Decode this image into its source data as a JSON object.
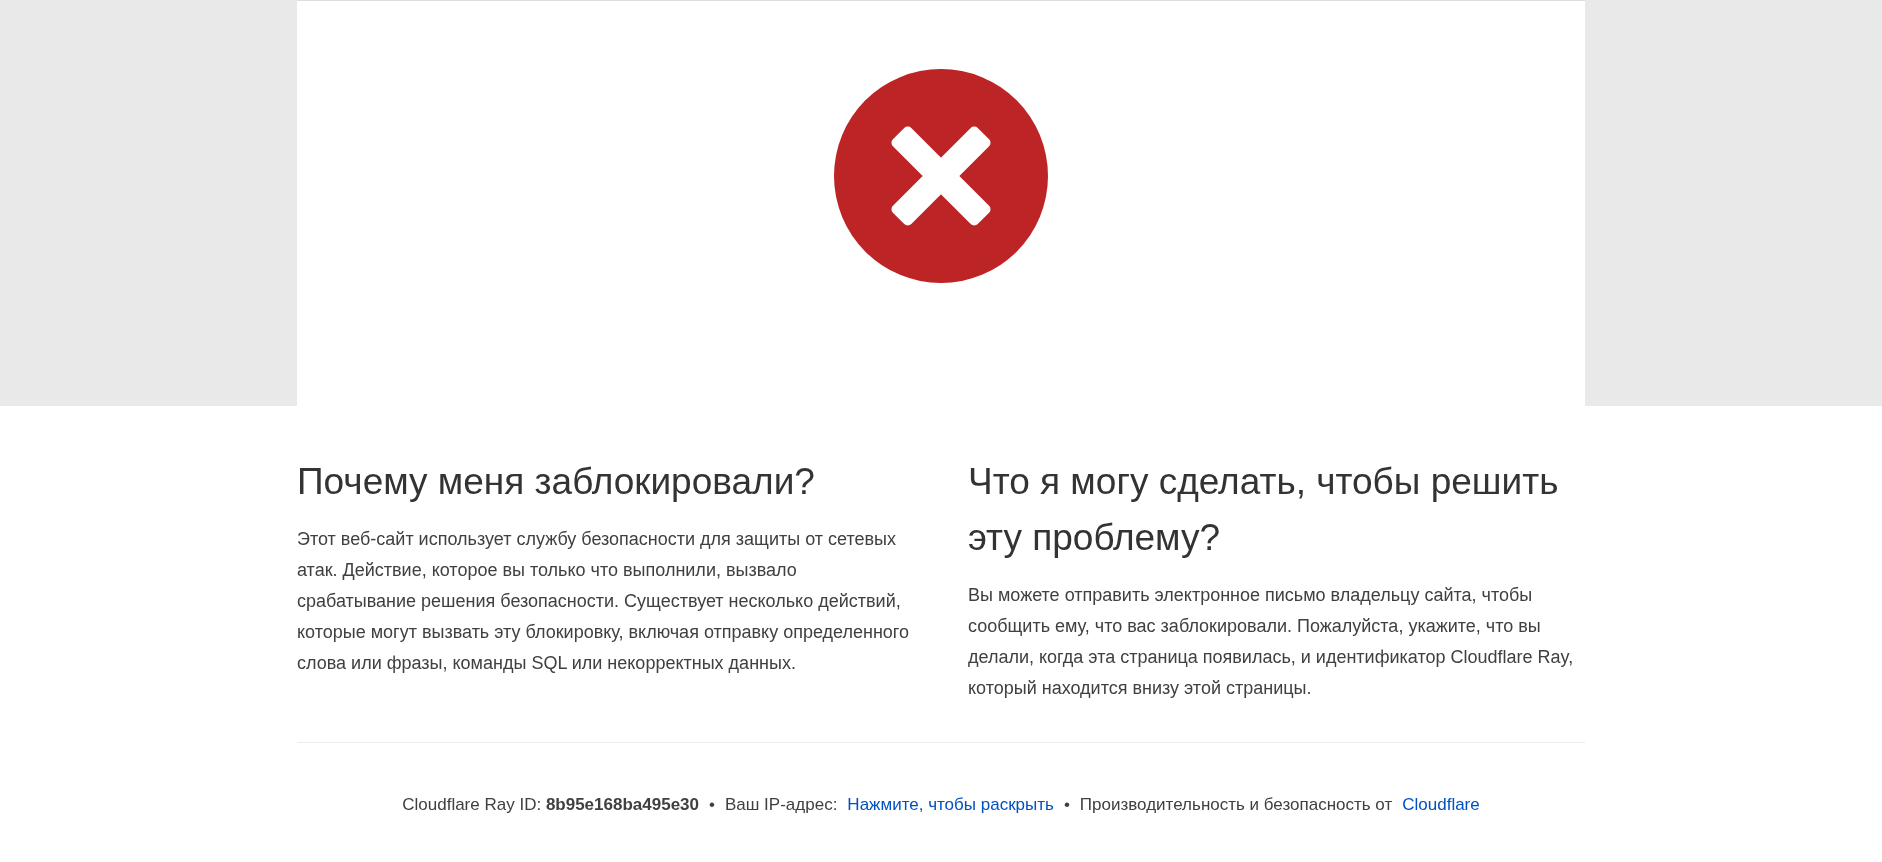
{
  "banner": {
    "kind": "blocked"
  },
  "sections": [
    {
      "heading": "Почему меня заблокировали?",
      "text": "Этот веб-сайт использует службу безопасности для защиты от сетевых атак. Действие, которое вы только что выполнили, вызвало срабатывание решения безопасности. Существует несколько действий, которые могут вызвать эту блокировку, включая отправку определенного слова или фразы, команды SQL или некорректных данных."
    },
    {
      "heading": "Что я могу сделать, чтобы решить эту проблему?",
      "text": "Вы можете отправить электронное письмо владельцу сайта, чтобы сообщить ему, что вас заблокировали. Пожалуйста, укажите, что вы делали, когда эта страница появилась, и идентификатор Cloudflare Ray, который находится внизу этой страницы."
    }
  ],
  "footer": {
    "ray": "Cloudflare Ray ID: **8b95e168ba495e30**",
    "separator_1": "•",
    "ip_label": "Ваш IP-адрес:",
    "ip_link": "Нажмите, чтобы раскрыть",
    "separator_2": "•",
    "performance_label": "Производительность и безопасность от",
    "provider_link": "Cloudflare"
  }
}
